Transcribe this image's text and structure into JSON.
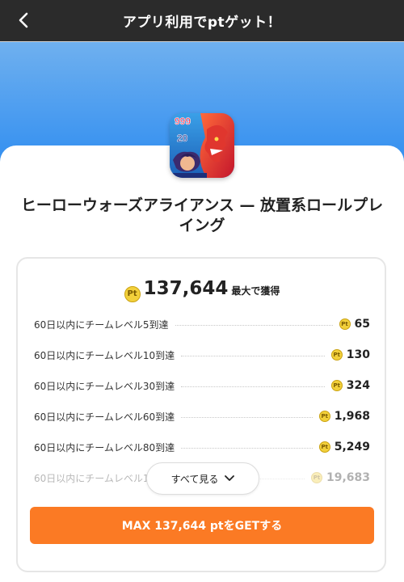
{
  "header": {
    "title": "アプリ利用でptゲット！"
  },
  "app": {
    "name": "ヒーローウォーズアライアンス — 放置系ロールプレイング",
    "icon_numbers": [
      "999",
      "20"
    ]
  },
  "reward": {
    "coin_label": "Pt",
    "total": "137,644",
    "total_suffix": "最大で獲得",
    "tasks": [
      {
        "label": "60日以内にチームレベル5到達",
        "points": "65"
      },
      {
        "label": "60日以内にチームレベル10到達",
        "points": "130"
      },
      {
        "label": "60日以内にチームレベル30到達",
        "points": "324"
      },
      {
        "label": "60日以内にチームレベル60到達",
        "points": "1,968"
      },
      {
        "label": "60日以内にチームレベル80到達",
        "points": "5,249"
      },
      {
        "label": "60日以内にチームレベル1",
        "points": "19,683"
      }
    ],
    "see_all": "すべて見る",
    "cta": "MAX 137,644 ptをGETする"
  },
  "colors": {
    "accent": "#fb7a24",
    "header_bg": "#2b2b2b",
    "hero_blue": "#2f8df0",
    "coin": "#f2d03b"
  }
}
